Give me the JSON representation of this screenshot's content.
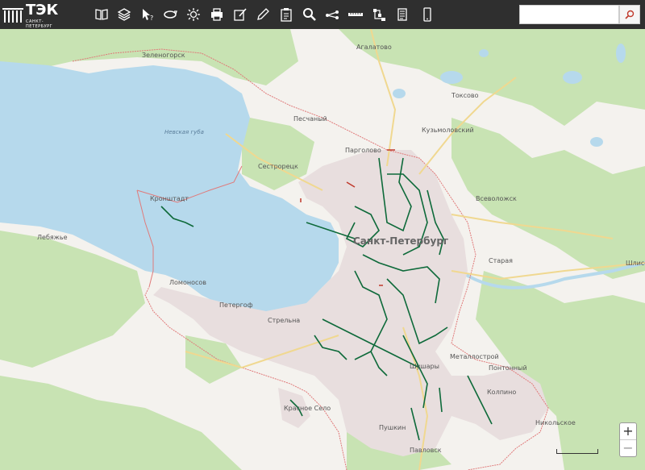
{
  "header": {
    "logo_text": "ТЭК",
    "logo_sub": "САНКТ-ПЕТЕРБУРГ"
  },
  "toolbar": {
    "tools": [
      {
        "name": "map-book-icon"
      },
      {
        "name": "layers-icon"
      },
      {
        "name": "identify-cursor-icon"
      },
      {
        "name": "rotate-icon"
      },
      {
        "name": "brightness-icon"
      },
      {
        "name": "print-icon"
      },
      {
        "name": "edit-note-icon"
      },
      {
        "name": "pencil-icon"
      },
      {
        "name": "clipboard-icon"
      },
      {
        "name": "search-icon"
      },
      {
        "name": "route-icon"
      },
      {
        "name": "ruler-icon"
      },
      {
        "name": "network-icon"
      },
      {
        "name": "document-icon"
      },
      {
        "name": "mobile-icon"
      }
    ]
  },
  "search": {
    "value": "",
    "placeholder": ""
  },
  "map": {
    "labels": {
      "zelenogorsk": "Зеленогорск",
      "agalatovo": "Агалатово",
      "toksovo": "Токсово",
      "peschany": "Песчаный",
      "kuzmolovsky": "Кузьмоловский",
      "nevskaya_guba": "Невская губа",
      "pargolovo": "Парголово",
      "sestroretsk": "Сестрорецк",
      "kronshtadt": "Кронштадт",
      "vsevolozhsk": "Всеволожск",
      "lebyazhye": "Лебяжье",
      "spb": "Санкт-Петербург",
      "staraya": "Старая",
      "shlisselburg": "Шлиссельбург",
      "lomonosov": "Ломоносов",
      "peterhof": "Петергоф",
      "strelna": "Стрельна",
      "metallostroy": "Металлострой",
      "pontonny": "Понтонный",
      "shushary": "Шушары",
      "kolpino": "Колпино",
      "krasnoe_selo": "Красное Село",
      "pushkin": "Пушкин",
      "nikolskoe": "Никольское",
      "pavlovsk": "Павловск"
    }
  },
  "controls": {
    "zoom_in": "+",
    "zoom_out": "−"
  },
  "colors": {
    "toolbar": "#2f2f2f",
    "water": "#b6d9ec",
    "forest": "#c8e3b3",
    "city": "#e8dede",
    "boundary": "#e07a7a",
    "network": "#0e6a3a"
  }
}
